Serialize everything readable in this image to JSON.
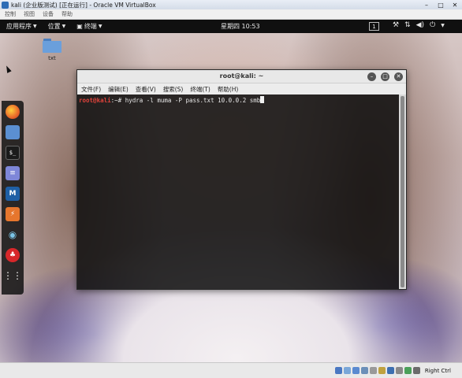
{
  "vbox": {
    "title": "kali (企业版测试) [正在运行] - Oracle VM VirtualBox",
    "menu": [
      "控制",
      "视图",
      "设备",
      "帮助"
    ],
    "host_key": "Right Ctrl",
    "status_icons": [
      {
        "name": "hdd-icon",
        "color": "#4a78c2"
      },
      {
        "name": "optical-drive-icon",
        "color": "#7aa7d8"
      },
      {
        "name": "audio-icon",
        "color": "#5a8ad0"
      },
      {
        "name": "network-icon",
        "color": "#6b8fb8"
      },
      {
        "name": "usb-icon",
        "color": "#999999"
      },
      {
        "name": "shared-folder-icon",
        "color": "#c0a23f"
      },
      {
        "name": "display-icon",
        "color": "#3d6fb0"
      },
      {
        "name": "recording-icon",
        "color": "#888888"
      },
      {
        "name": "cpu-icon",
        "color": "#4aa05a"
      },
      {
        "name": "mouse-integration-icon",
        "color": "#6b6b6b"
      }
    ]
  },
  "gnome": {
    "applications": "应用程序",
    "places": "位置",
    "terminal_menu": "终端",
    "clock": "星期四 10:53",
    "workspace": "1"
  },
  "desktop": {
    "file_label": "txt"
  },
  "dock": {
    "items": [
      {
        "name": "firefox-icon"
      },
      {
        "name": "files-icon"
      },
      {
        "name": "terminal-icon",
        "glyph": "$_"
      },
      {
        "name": "notes-icon",
        "glyph": "≡"
      },
      {
        "name": "metasploit-icon",
        "glyph": "M"
      },
      {
        "name": "burpsuite-icon",
        "glyph": "⚡"
      },
      {
        "name": "eye-icon",
        "glyph": "◉"
      },
      {
        "name": "cherrytree-icon",
        "glyph": "♣"
      },
      {
        "name": "show-apps-icon",
        "glyph": "⋮⋮"
      }
    ]
  },
  "terminal": {
    "title": "root@kali: ~",
    "menu": [
      "文件(F)",
      "编辑(E)",
      "查看(V)",
      "搜索(S)",
      "终端(T)",
      "帮助(H)"
    ],
    "prompt_user": "root@kali",
    "prompt_rest": ":~# ",
    "command": "hydra -l muma -P pass.txt 10.0.0.2 smb"
  }
}
